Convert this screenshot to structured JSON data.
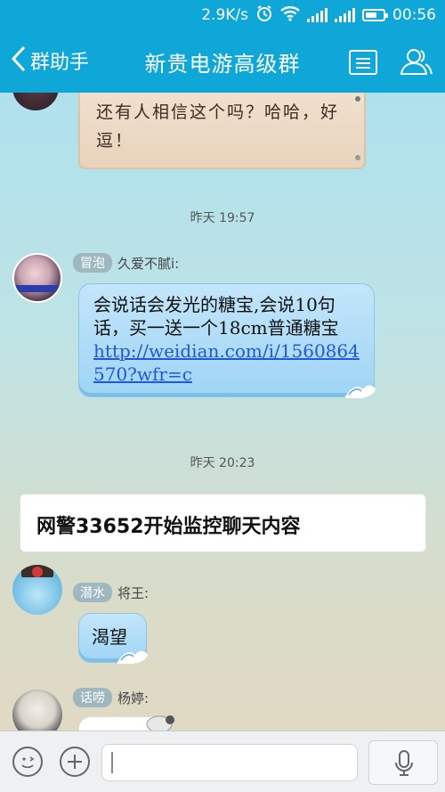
{
  "status_bar": {
    "speed": "2.9K/s",
    "time": "00:56"
  },
  "header": {
    "back_label": "群助手",
    "title": "新贵电游高级群"
  },
  "messages": {
    "image_text": "还有人相信这个吗？哈哈，好逗！",
    "time1": "昨天 19:57",
    "msg1_rank": "冒泡",
    "msg1_name": "久爱不腻i:",
    "msg1_text": "会说话会发光的糖宝,会说10句话，买一送一个18cm普通糖宝",
    "msg1_link": "http://weidian.com/i/1560864570?wfr=c",
    "time2": "昨天 20:23",
    "notice_text": "网警33652开始监控聊天内容",
    "msg2_rank": "潜水",
    "msg2_name": "将王:",
    "msg2_text": "渴望",
    "msg3_rank": "话唠",
    "msg3_name": "杨婷:"
  },
  "colors": {
    "header_bg": "#0fa7d8",
    "bubble": "#a8d9f7",
    "link": "#1f58d8"
  },
  "icons": [
    "wifi-icon",
    "alarm-icon",
    "signal-icon",
    "battery-icon",
    "back-chevron-icon",
    "menu-list-icon",
    "group-members-icon",
    "emoji-icon",
    "plus-icon",
    "microphone-icon"
  ]
}
